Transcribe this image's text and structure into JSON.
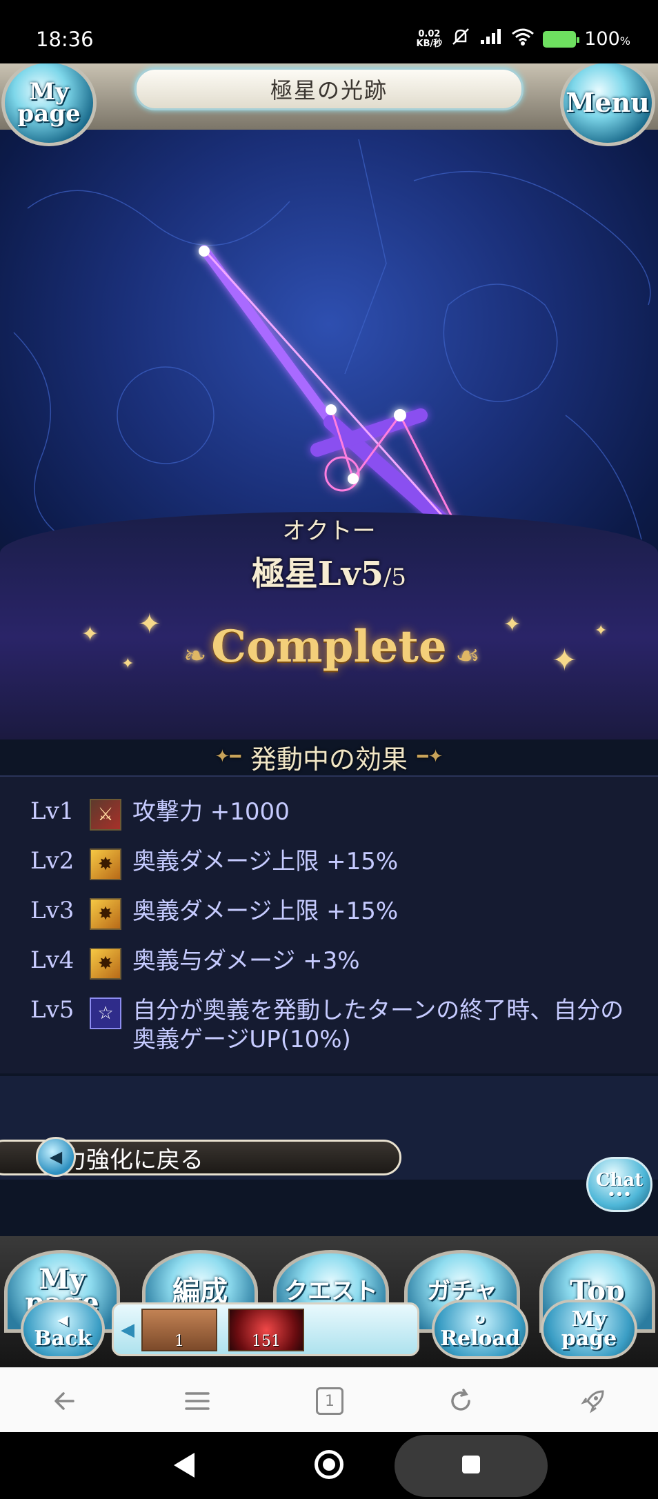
{
  "status_bar": {
    "time": "18:36",
    "net_speed_value": "0.02",
    "net_speed_unit": "KB/秒",
    "battery": "100",
    "battery_unit": "%"
  },
  "header": {
    "title": "極星の光跡",
    "mypage_line1": "My",
    "mypage_line2": "page",
    "menu_label": "Menu"
  },
  "crest": {
    "name": "オクトー",
    "level_label": "極星Lv5",
    "level_max": "/5",
    "status": "Complete"
  },
  "effects": {
    "section_title": "発動中の効果",
    "items": [
      {
        "level": "Lv1",
        "icon": "attack-up-icon",
        "text": "攻撃力 +1000"
      },
      {
        "level": "Lv2",
        "icon": "ougi-cap-up-icon",
        "text": "奥義ダメージ上限 +15%"
      },
      {
        "level": "Lv3",
        "icon": "ougi-cap-up-icon",
        "text": "奥義ダメージ上限 +15%"
      },
      {
        "level": "Lv4",
        "icon": "ougi-damage-up-icon",
        "text": "奥義与ダメージ +3%"
      },
      {
        "level": "Lv5",
        "icon": "star-icon",
        "text": "自分が奥義を発動したターンの終了時、自分の奥義ゲージUP(10%)"
      }
    ]
  },
  "back_link": "能力強化に戻る",
  "chat_label": "Chat",
  "bottom_nav": {
    "mypage_line1": "My",
    "mypage_line2": "page",
    "party": "編成",
    "quest": "クエスト",
    "gacha": "ガチャ",
    "top": "Top",
    "back": "Back",
    "reload": "Reload",
    "mypage2_line1": "My",
    "mypage2_line2": "page"
  },
  "item_tray": {
    "items": [
      {
        "name": "potion-item",
        "count": "1"
      },
      {
        "name": "stamina-item",
        "count": "151"
      }
    ]
  },
  "browser_bar": {
    "tab_count": "1"
  }
}
